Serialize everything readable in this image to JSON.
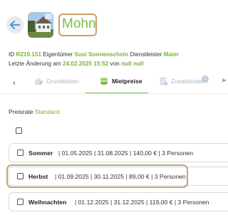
{
  "header": {
    "title": "Mohn"
  },
  "meta": {
    "line1": {
      "id_label": "ID",
      "id_value": "R219.151",
      "owner_label": "Eigentümer",
      "owner_value": "Susi Sonnenschein",
      "provider_label": "Dienstleister",
      "provider_value": "Maier"
    },
    "line2": {
      "changed_label": "Letzte Änderung am",
      "changed_value": "24.02.2025 15:52",
      "by_label": "von",
      "by_value": "null null"
    }
  },
  "tabs": {
    "items": [
      {
        "label": "Grunddaten",
        "icon": "house-pen-icon"
      },
      {
        "label": "Mietpreise",
        "icon": "coins-icon"
      },
      {
        "label": "Zusatzkosten",
        "icon": "receipt-plus-icon"
      }
    ],
    "badge": "0"
  },
  "preisrate": {
    "label": "Preisrate",
    "value": "Standard"
  },
  "rows": [
    {
      "name": "Sommer",
      "info": "| 01.05.2025 | 31.08.2025 | 140,00 € | 3 Personen"
    },
    {
      "name": "Herbst",
      "info": "| 01.09.2025 | 30.11.2025 | 89,00 € | 3 Personen"
    },
    {
      "name": "Weihnachten",
      "info": "| 01.12.2025 | 31.12.2025 | 119,00 € | 3 Personen"
    }
  ],
  "colors": {
    "accent_green": "#79c143",
    "highlight": "#c9a06a",
    "row_border": "#d2dbe6"
  }
}
